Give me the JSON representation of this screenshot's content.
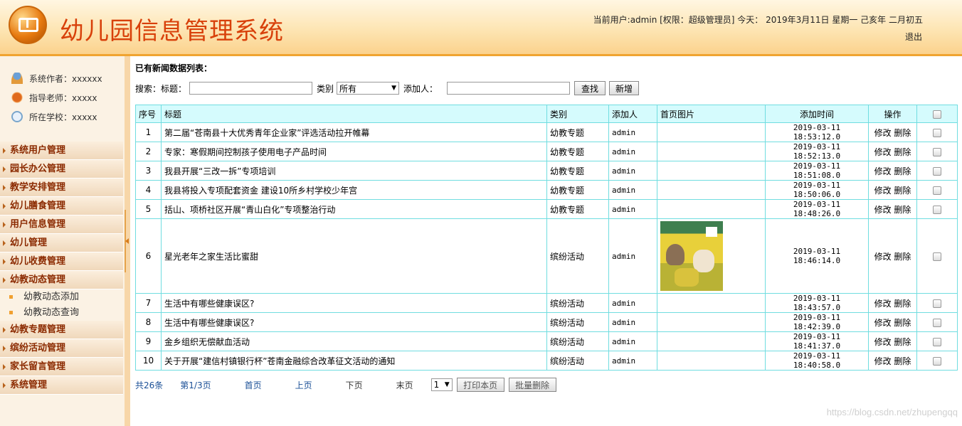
{
  "header": {
    "title": "幼儿园信息管理系统",
    "user_info": "当前用户:admin [权限：超级管理员] 今天： 2019年3月11日  星期一  己亥年 二月初五",
    "logout": "退出"
  },
  "sidebar": {
    "info": [
      {
        "label": "系统作者：xxxxxx",
        "icon": "user-icon"
      },
      {
        "label": "指导老师：xxxxx",
        "icon": "teacher-icon"
      },
      {
        "label": "所在学校：xxxxx",
        "icon": "school-icon"
      }
    ],
    "menu": [
      "系统用户管理",
      "园长办公管理",
      "教学安排管理",
      "幼儿膳食管理",
      "用户信息管理",
      "幼儿管理",
      "幼儿收费管理",
      "幼教动态管理"
    ],
    "submenu": [
      "幼教动态添加",
      "幼教动态查询"
    ],
    "menu_after": [
      "幼教专题管理",
      "缤纷活动管理",
      "家长留言管理",
      "系统管理"
    ]
  },
  "main": {
    "caption": "已有新闻数据列表：",
    "search": {
      "prefix": "搜索：",
      "title_label": "标题：",
      "title_value": "",
      "category_label": "类别",
      "category_value": "所有",
      "adder_label": "添加人：",
      "adder_value": "",
      "search_button": "查找",
      "add_button": "新增"
    },
    "columns": [
      "序号",
      "标题",
      "类别",
      "添加人",
      "首页图片",
      "添加时间",
      "操作"
    ],
    "rows": [
      {
        "idx": "1",
        "title": "第二届“苍南县十大优秀青年企业家”评选活动拉开帷幕",
        "category": "幼教专题",
        "adder": "admin",
        "image": false,
        "time": "2019-03-11 18:53:12.0"
      },
      {
        "idx": "2",
        "title": "专家：寒假期间控制孩子使用电子产品时间",
        "category": "幼教专题",
        "adder": "admin",
        "image": false,
        "time": "2019-03-11 18:52:13.0"
      },
      {
        "idx": "3",
        "title": "我县开展“三改一拆”专项培训",
        "category": "幼教专题",
        "adder": "admin",
        "image": false,
        "time": "2019-03-11 18:51:08.0"
      },
      {
        "idx": "4",
        "title": "我县将投入专项配套资金 建设10所乡村学校少年宫",
        "category": "幼教专题",
        "adder": "admin",
        "image": false,
        "time": "2019-03-11 18:50:06.0"
      },
      {
        "idx": "5",
        "title": "括山、项桥社区开展“青山白化”专项整治行动",
        "category": "幼教专题",
        "adder": "admin",
        "image": false,
        "time": "2019-03-11 18:48:26.0"
      },
      {
        "idx": "6",
        "title": "星光老年之家生活比蜜甜",
        "category": "缤纷活动",
        "adder": "admin",
        "image": true,
        "time": "2019-03-11 18:46:14.0"
      },
      {
        "idx": "7",
        "title": "生活中有哪些健康误区?",
        "category": "缤纷活动",
        "adder": "admin",
        "image": false,
        "time": "2019-03-11 18:43:57.0"
      },
      {
        "idx": "8",
        "title": "生活中有哪些健康误区?",
        "category": "缤纷活动",
        "adder": "admin",
        "image": false,
        "time": "2019-03-11 18:42:39.0"
      },
      {
        "idx": "9",
        "title": "金乡组织无偿献血活动",
        "category": "缤纷活动",
        "adder": "admin",
        "image": false,
        "time": "2019-03-11 18:41:37.0"
      },
      {
        "idx": "10",
        "title": "关于开展“建信村镇银行杯”苍南金融综合改革征文活动的通知",
        "category": "缤纷活动",
        "adder": "admin",
        "image": false,
        "time": "2019-03-11 18:40:58.0"
      }
    ],
    "row_actions": {
      "edit": "修改",
      "delete": "删除"
    },
    "pager": {
      "total": "共26条",
      "page_info": "第1/3页",
      "first": "首页",
      "prev": "上页",
      "next": "下页",
      "last": "末页",
      "page_select": "1",
      "print_button": "打印本页",
      "batch_delete_button": "批量删除"
    }
  },
  "watermark": "https://blog.csdn.net/zhupengqq"
}
